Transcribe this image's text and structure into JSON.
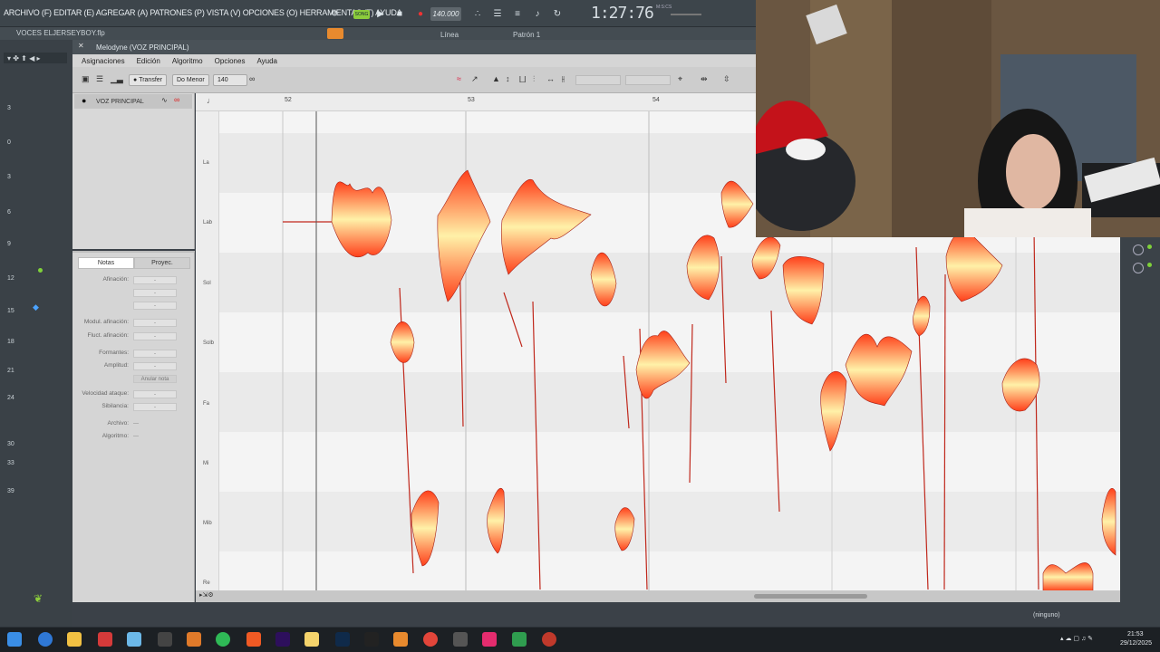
{
  "daw": {
    "menu": "ARCHIVO (F) EDITAR (E) AGREGAR (A) PATRONES (P) VISTA (V) OPCIONES (O) HERRAMIENTAS (T) AYUDA",
    "song_badge": "SONG",
    "tempo": "140.000",
    "clock": "1:27:76",
    "clock_unit": "M:S:CS",
    "project_name": "VOCES ELJERSEYBOY.flp",
    "pattern": "Patrón 1",
    "snap": "Línea"
  },
  "melodyne": {
    "window_title": "Melodyne (VOZ PRINCIPAL)",
    "menu": [
      "Asignaciones",
      "Edición",
      "Algoritmo",
      "Opciones",
      "Ayuda"
    ],
    "toolbar": {
      "transfer": "Transfer",
      "key": "Do Menor",
      "tempo": "140"
    },
    "track_name": "VOZ PRINCIPAL",
    "inspector_tabs": [
      "Notas",
      "Proyec."
    ],
    "inspector_rows": [
      {
        "label": "Afinación:",
        "value": "-"
      },
      {
        "label": "",
        "value": "-"
      },
      {
        "label": "",
        "value": "-"
      },
      {
        "label": "Modul. afinación:",
        "value": "-"
      },
      {
        "label": "Fluct. afinación:",
        "value": "-"
      },
      {
        "label": "Formantes:",
        "value": "-"
      },
      {
        "label": "Amplitud:",
        "value": "-"
      },
      {
        "label": "",
        "value": "Anular nota"
      },
      {
        "label": "Velocidad ataque:",
        "value": "-"
      },
      {
        "label": "Sibilancia:",
        "value": "-"
      },
      {
        "label": "Archivo:",
        "value": "---"
      },
      {
        "label": "Algoritmo:",
        "value": "---"
      }
    ],
    "bars": [
      "52",
      "53",
      "54"
    ],
    "note_labels": [
      "La",
      "Lab",
      "Sol",
      "Solb",
      "Fa",
      "Mi",
      "Mib",
      "Re"
    ],
    "mixer_ruler": [
      "3",
      "0",
      "3",
      "6",
      "9",
      "12",
      "15",
      "18",
      "21",
      "24",
      "30",
      "33",
      "39"
    ]
  },
  "status": {
    "output": "(ninguno)",
    "time": "21:53",
    "date": "29/12/2025"
  },
  "colors": {
    "blob_outer": "#ff5a1e",
    "blob_inner": "#fff3b0",
    "pitch_line": "#c0281c",
    "accent_green": "#8ccc3c"
  }
}
